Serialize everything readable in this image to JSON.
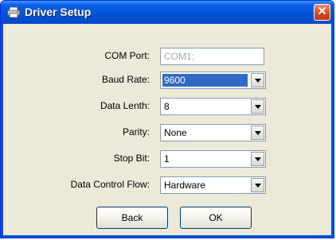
{
  "window": {
    "title": "Driver Setup",
    "close_glyph": "✕",
    "app_icon": "printer-icon"
  },
  "fields": {
    "com_port": {
      "label": "COM Port:",
      "value": "COM1;"
    },
    "baud_rate": {
      "label": "Baud Rate:",
      "value": "9600"
    },
    "data_length": {
      "label": "Data Lenth:",
      "value": "8"
    },
    "parity": {
      "label": "Parity:",
      "value": "None"
    },
    "stop_bit": {
      "label": "Stop Bit:",
      "value": "1"
    },
    "flow_control": {
      "label": "Data Control Flow:",
      "value": "Hardware"
    }
  },
  "buttons": {
    "back": "Back",
    "ok": "OK"
  },
  "colors": {
    "titlebar": "#0453d6",
    "selection": "#316ac5",
    "face": "#ece9d8",
    "close": "#d8421a"
  }
}
